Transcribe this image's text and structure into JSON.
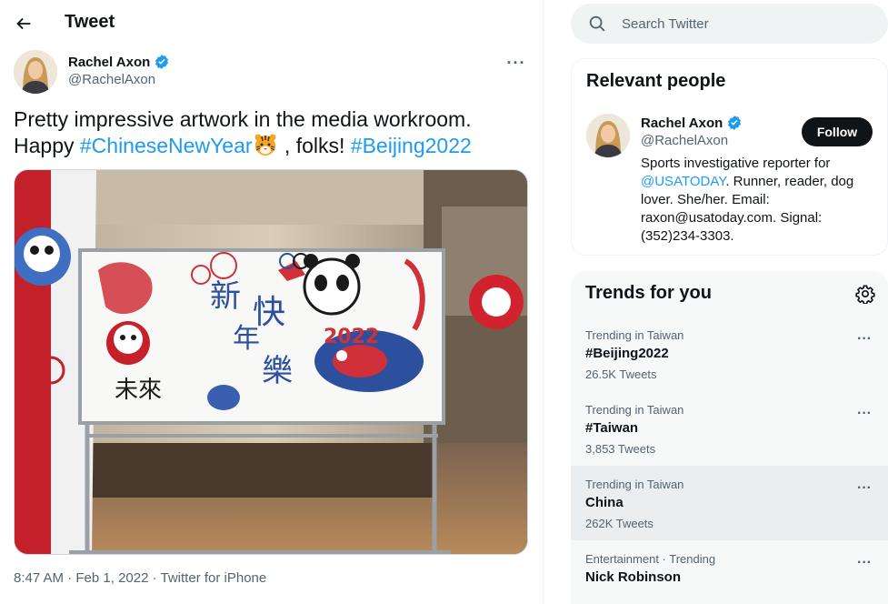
{
  "header": {
    "title": "Tweet",
    "back_icon": "arrow-left-icon"
  },
  "tweet": {
    "author_name": "Rachel Axon",
    "author_handle": "@RachelAxon",
    "verified": true,
    "more_label": "···",
    "text_line1": "Pretty impressive artwork in the media workroom.",
    "text_happy": "Happy ",
    "hashtag1": "#ChineseNewYear",
    "emoji": "tiger-face-icon",
    "text_folks": " , folks! ",
    "hashtag2": "#Beijing2022",
    "time": "8:47 AM",
    "date": "Feb 1, 2022",
    "source": "Twitter for iPhone",
    "separator": " · "
  },
  "search": {
    "placeholder": "Search Twitter"
  },
  "relevant_people": {
    "title": "Relevant people",
    "name": "Rachel Axon",
    "handle": "@RachelAxon",
    "follow_label": "Follow",
    "bio_prefix": "Sports investigative reporter for ",
    "bio_mention": "@USATODAY",
    "bio_rest": ". Runner, reader, dog lover. She/her. Email: raxon@usatoday.com. Signal: (352)234-3303."
  },
  "trends": {
    "title": "Trends for you",
    "items": [
      {
        "context": "Trending in Taiwan",
        "name": "#Beijing2022",
        "count": "26.5K Tweets"
      },
      {
        "context": "Trending in Taiwan",
        "name": "#Taiwan",
        "count": "3,853 Tweets"
      },
      {
        "context": "Trending in Taiwan",
        "name": "China",
        "count": "262K Tweets"
      },
      {
        "context": "Entertainment · Trending",
        "name": "Nick Robinson",
        "count": ""
      }
    ],
    "more_label": "···"
  },
  "colors": {
    "accent": "#1d9bf0",
    "text": "#0f1419",
    "muted": "#536471"
  }
}
